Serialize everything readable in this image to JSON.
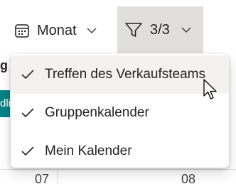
{
  "toolbar": {
    "view_label": "Monat",
    "view_icon": "calendar-month-icon",
    "filter_label": "3/3",
    "filter_icon": "filter-icon"
  },
  "calendar": {
    "partial_heading": "g",
    "partial_event_text": "dli",
    "day_numbers": [
      "07",
      "08"
    ],
    "event_color": "#038387"
  },
  "filter_menu": {
    "items": [
      {
        "label": "Treffen des Verkaufsteams",
        "checked": true
      },
      {
        "label": "Gruppenkalender",
        "checked": true
      },
      {
        "label": "Mein Kalender",
        "checked": true
      }
    ]
  }
}
